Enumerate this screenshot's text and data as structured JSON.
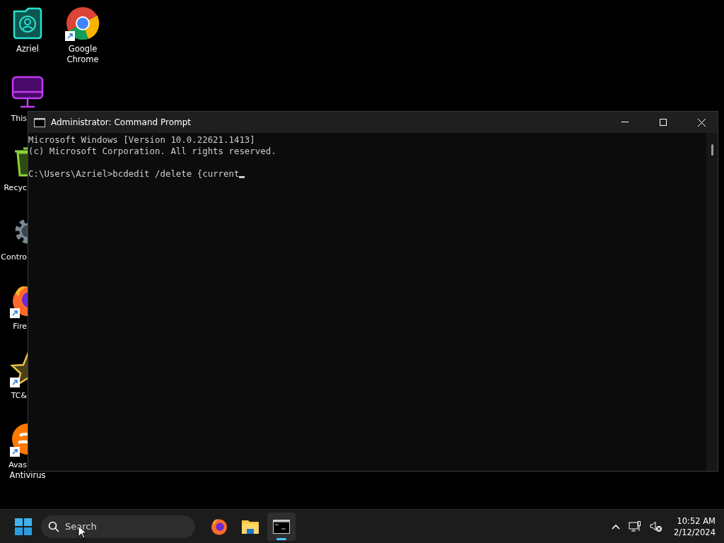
{
  "desktop": {
    "icons": [
      {
        "kind": "user-folder",
        "label": [
          "Azriel"
        ],
        "shortcut": false
      },
      {
        "kind": "chrome",
        "label": [
          "Google",
          "Chrome"
        ],
        "shortcut": true
      },
      {
        "kind": "monitor",
        "label": [
          "This"
        ],
        "shortcut": false
      },
      {
        "kind": "bin",
        "label": [
          "Recyc"
        ],
        "shortcut": false
      },
      {
        "kind": "gear",
        "label": [
          "Contro"
        ],
        "shortcut": false
      },
      {
        "kind": "firefox",
        "label": [
          "Fire"
        ],
        "shortcut": true
      },
      {
        "kind": "star",
        "label": [
          "TC&"
        ],
        "shortcut": true
      },
      {
        "kind": "avast",
        "label": [
          "Avas",
          "Antivirus"
        ],
        "shortcut": true
      }
    ]
  },
  "window": {
    "title": "Administrator: Command Prompt",
    "console": {
      "blocks": [
        [
          "Microsoft Windows [Version 10.0.22621.1413]",
          "(c) Microsoft Corporation. All rights reserved."
        ],
        [
          "C:\\Users\\Azriel>bcdedit /delete {current"
        ]
      ],
      "cursor": true
    }
  },
  "taskbar": {
    "search": {
      "placeholder": "Search"
    },
    "apps": [
      {
        "kind": "firefox",
        "selected": false
      },
      {
        "kind": "explorer",
        "selected": false
      },
      {
        "kind": "terminal",
        "selected": true
      }
    ],
    "clock": {
      "time": "10:52 AM",
      "date": "2/12/2024"
    }
  }
}
